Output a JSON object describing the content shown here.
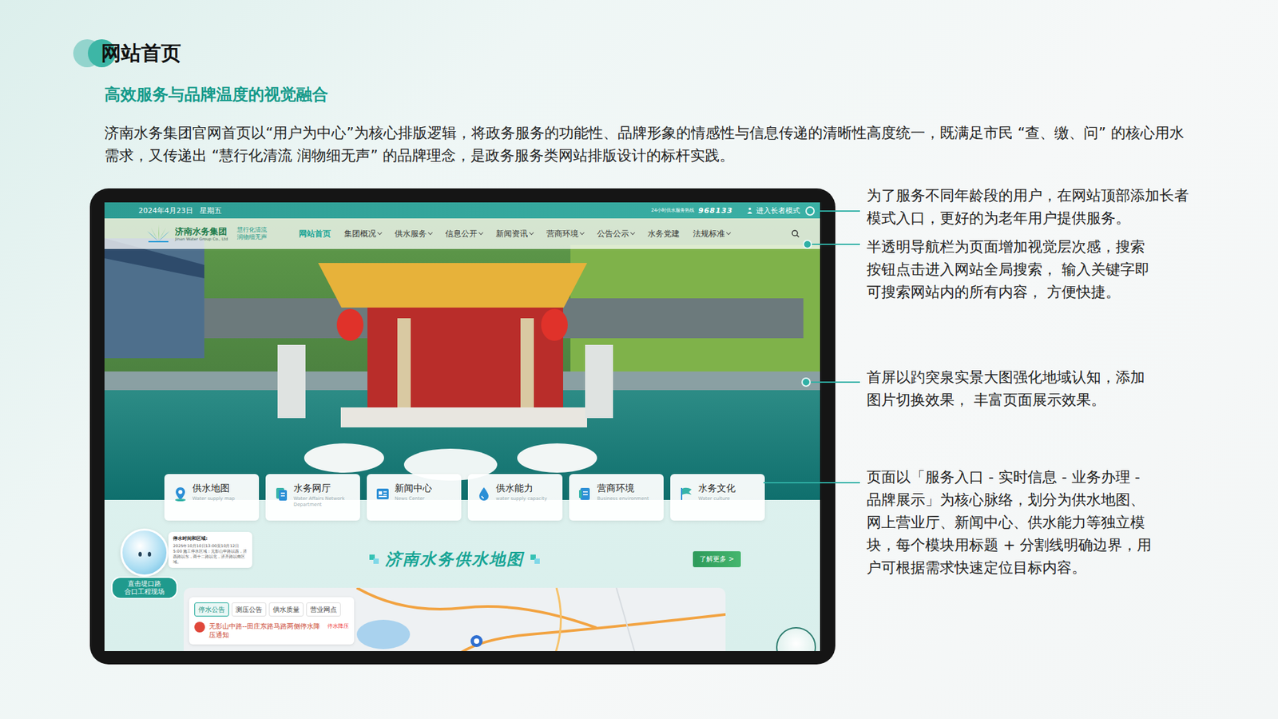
{
  "slide": {
    "title": "网站首页",
    "subtitle": "高效服务与品牌温度的视觉融合",
    "description": "济南水务集团官网首页以“用户为中心”为核心排版逻辑，将政务服务的功能性、品牌形象的情感性与信息传递的清晰性高度统一，既满足市民 “查、缴、问” 的核心用水需求，又传递出 “慧行化清流 润物细无声” 的品牌理念，是政务服务类网站排版设计的标杆实践。"
  },
  "annotations": [
    {
      "lines": [
        "为了服务不同年龄段的用户，在网站顶部添加长者",
        "模式入口，更好的为老年用户提供服务。"
      ]
    },
    {
      "lines": [
        "半透明导航栏为页面增加视觉层次感，搜索",
        "按钮点击进入网站全局搜索， 输入关键字即",
        "可搜索网站内的所有内容， 方便快捷。"
      ]
    },
    {
      "lines": [
        "首屏以趵突泉实景大图强化地域认知，添加",
        "图片切换效果， 丰富页面展示效果。"
      ]
    },
    {
      "lines": [
        "页面以「服务入口 - 实时信息 - 业务办理 -",
        "品牌展示」为核心脉络，划分为供水地图、",
        "网上营业厅、新闻中心、供水能力等独立模",
        "块，每个模块用标题 + 分割线明确边界，用",
        "户可根据需求快速定位目标内容。"
      ]
    }
  ],
  "website": {
    "topbar": {
      "date": "2024年4月23日",
      "weekday": "星期五",
      "hotline_label": "24小时供水服务热线",
      "hotline": "968133",
      "elder_mode": "进入长者模式"
    },
    "logo": {
      "name": "济南水务集团",
      "english": "Jinan Water Group Co., Ltd",
      "slogan": [
        "慧行化清流",
        "润物细无声"
      ]
    },
    "nav": [
      {
        "label": "网站首页",
        "selected": true,
        "dropdown": false
      },
      {
        "label": "集团概况",
        "selected": false,
        "dropdown": true
      },
      {
        "label": "供水服务",
        "selected": false,
        "dropdown": true
      },
      {
        "label": "信息公开",
        "selected": false,
        "dropdown": true
      },
      {
        "label": "新闻资讯",
        "selected": false,
        "dropdown": true
      },
      {
        "label": "营商环境",
        "selected": false,
        "dropdown": true
      },
      {
        "label": "公告公示",
        "selected": false,
        "dropdown": true
      },
      {
        "label": "水务党建",
        "selected": false,
        "dropdown": false
      },
      {
        "label": "法规标准",
        "selected": false,
        "dropdown": true
      }
    ],
    "cards": [
      {
        "title": "供水地图",
        "subtitle": "Water supply map"
      },
      {
        "title": "水务网厅",
        "subtitle": "Water Affairs Network Department"
      },
      {
        "title": "新闻中心",
        "subtitle": "News Center"
      },
      {
        "title": "供水能力",
        "subtitle": "water supply capacity"
      },
      {
        "title": "营商环境",
        "subtitle": "Business environment"
      },
      {
        "title": "水务文化",
        "subtitle": "Water culture"
      }
    ],
    "notice": {
      "title": "停水时间和区域:",
      "body": "2025年10月10日13:00至10月12日5:00 施工停水区域：无影山中路以西，济西路以东，商十二路以北，济齐路以南区域。"
    },
    "live_badge": [
      "直击堤口路",
      "合口工程现场"
    ],
    "map_section": {
      "title": "济南水务供水地图",
      "more": "了解更多 >",
      "tabs": [
        {
          "label": "停水公告",
          "selected": true
        },
        {
          "label": "测压公告",
          "selected": false
        },
        {
          "label": "供水质量",
          "selected": false
        },
        {
          "label": "营业网点",
          "selected": false
        }
      ],
      "items": [
        {
          "title": "无影山中路--田庄东路马路两侧停水降压通知",
          "tag": "停水降压"
        }
      ]
    }
  }
}
